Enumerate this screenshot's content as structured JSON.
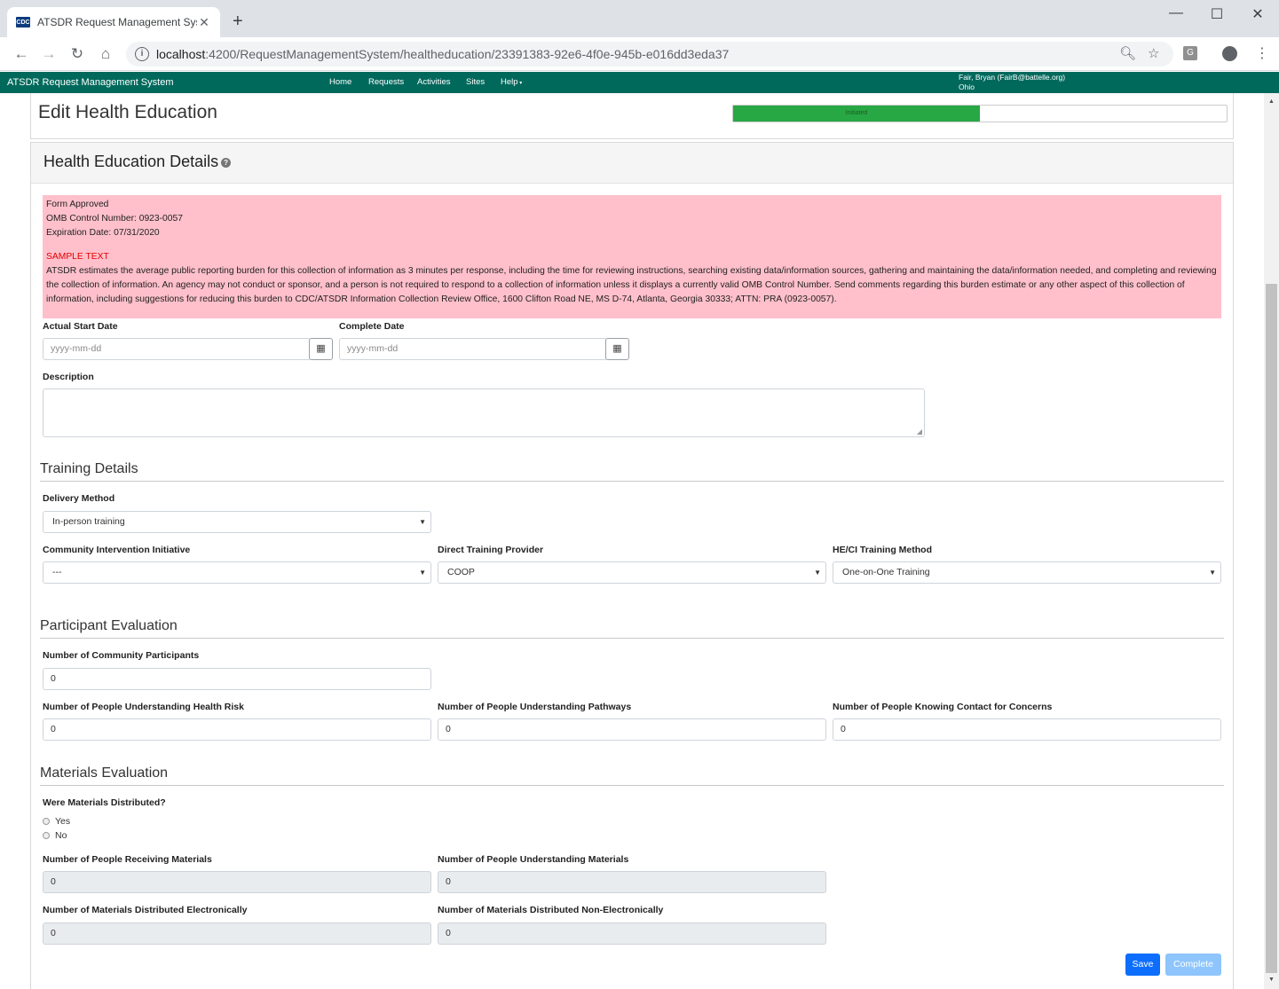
{
  "browser": {
    "tab_title": "ATSDR Request Management Sys",
    "favicon_text": "CDC",
    "url_host": "localhost",
    "url_path": ":4200/RequestManagementSystem/healtheducation/23391383-92e6-4f0e-945b-e016dd3eda37",
    "extension_label": "G"
  },
  "navbar": {
    "brand": "ATSDR Request Management System",
    "links": [
      "Home",
      "Requests",
      "Activities",
      "Sites",
      "Help"
    ],
    "user_name": "Fair, Bryan (FairB@battelle.org)",
    "user_state": "Ohio"
  },
  "page": {
    "title": "Edit Health Education",
    "status_label": "Initiated",
    "status_progress_pct": 50
  },
  "details": {
    "header": "Health Education Details",
    "notice": {
      "line1": "Form Approved",
      "line2": "OMB Control Number:  0923-0057",
      "line3": "Expiration Date:  07/31/2020",
      "sample": "SAMPLE TEXT",
      "body": "ATSDR estimates the average public reporting burden for this collection of information as 3 minutes per response, including the time for reviewing instructions, searching existing data/information sources, gathering and maintaining the data/information needed, and completing and reviewing the collection of information. An agency may not conduct or sponsor, and a person is not required to respond to a collection of information unless it displays a currently valid OMB Control Number. Send comments regarding this burden estimate or any other aspect of this collection of information, including suggestions for reducing this burden to CDC/ATSDR Information Collection Review Office, 1600 Clifton Road NE, MS D-74, Atlanta, Georgia 30333; ATTN: PRA (0923-0057)."
    },
    "start_date_label": "Actual Start Date",
    "start_date_placeholder": "yyyy-mm-dd",
    "complete_date_label": "Complete Date",
    "complete_date_placeholder": "yyyy-mm-dd",
    "description_label": "Description",
    "description_value": ""
  },
  "training": {
    "header": "Training Details",
    "delivery_label": "Delivery Method",
    "delivery_value": "In-person training",
    "cii_label": "Community Intervention Initiative",
    "cii_value": "---",
    "provider_label": "Direct Training Provider",
    "provider_value": "COOP",
    "method_label": "HE/CI Training Method",
    "method_value": "One-on-One Training"
  },
  "participant": {
    "header": "Participant Evaluation",
    "community_label": "Number of Community Participants",
    "community_value": "0",
    "health_risk_label": "Number of People Understanding Health Risk",
    "health_risk_value": "0",
    "pathways_label": "Number of People Understanding Pathways",
    "pathways_value": "0",
    "contact_label": "Number of People Knowing Contact for Concerns",
    "contact_value": "0"
  },
  "materials": {
    "header": "Materials Evaluation",
    "distributed_label": "Were Materials Distributed?",
    "yes_label": "Yes",
    "no_label": "No",
    "receiving_label": "Number of People Receiving Materials",
    "receiving_value": "0",
    "understanding_label": "Number of People Understanding Materials",
    "understanding_value": "0",
    "electronic_label": "Number of Materials Distributed Electronically",
    "electronic_value": "0",
    "nonelectronic_label": "Number of Materials Distributed Non-Electronically",
    "nonelectronic_value": "0"
  },
  "actions": {
    "save": "Save",
    "complete": "Complete"
  }
}
